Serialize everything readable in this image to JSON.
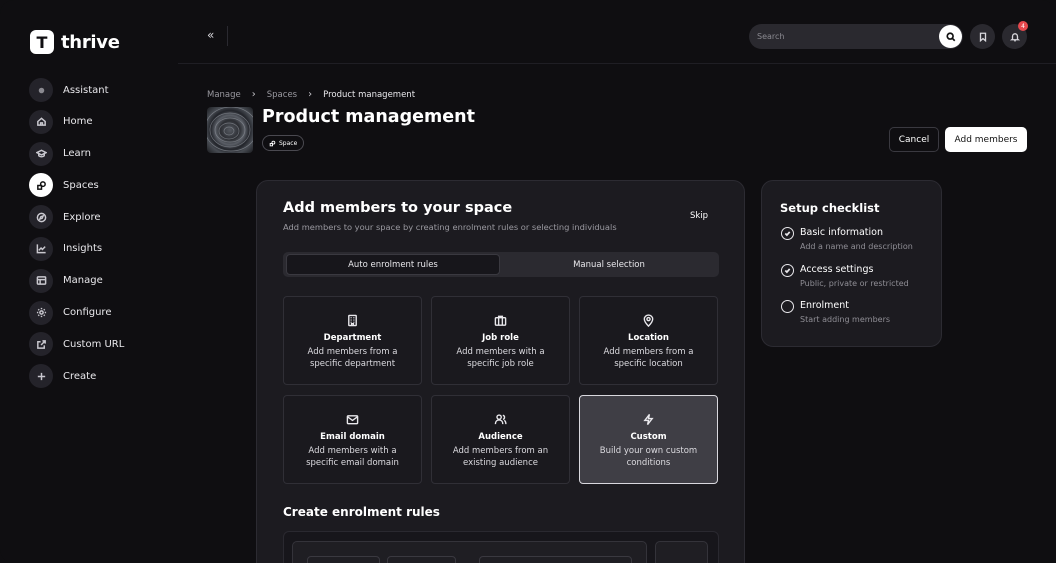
{
  "app": {
    "logo_letter": "T",
    "name": "thrive"
  },
  "sidebar": {
    "items": [
      {
        "label": "Assistant",
        "icon": "assistant-icon"
      },
      {
        "label": "Home",
        "icon": "home-icon"
      },
      {
        "label": "Learn",
        "icon": "graduation-cap-icon"
      },
      {
        "label": "Spaces",
        "icon": "spaces-icon",
        "active": true
      },
      {
        "label": "Explore",
        "icon": "compass-icon"
      },
      {
        "label": "Insights",
        "icon": "chart-icon"
      },
      {
        "label": "Manage",
        "icon": "manage-icon"
      },
      {
        "label": "Configure",
        "icon": "gear-icon"
      },
      {
        "label": "Custom URL",
        "icon": "external-link-icon"
      },
      {
        "label": "Create",
        "icon": "plus-icon"
      }
    ]
  },
  "topbar": {
    "collapse_label": "«",
    "search_placeholder": "Search",
    "notification_count": "4"
  },
  "breadcrumb": {
    "items": [
      "Manage",
      "Spaces",
      "Product management"
    ]
  },
  "header": {
    "title": "Product management",
    "pill_label": "Space",
    "cancel_label": "Cancel",
    "add_members_label": "Add members"
  },
  "card": {
    "title": "Add members to your space",
    "subtitle": "Add members to your space by creating enrolment rules or selecting individuals",
    "skip_label": "Skip",
    "tabs": [
      {
        "label": "Auto enrolment rules",
        "active": true
      },
      {
        "label": "Manual selection",
        "active": false
      }
    ],
    "options": [
      {
        "title": "Department",
        "desc": "Add members from a specific department",
        "icon": "building-icon"
      },
      {
        "title": "Job role",
        "desc": "Add members with a specific job role",
        "icon": "briefcase-icon"
      },
      {
        "title": "Location",
        "desc": "Add members from a specific location",
        "icon": "map-pin-icon"
      },
      {
        "title": "Email domain",
        "desc": "Add members with a specific email domain",
        "icon": "mail-icon"
      },
      {
        "title": "Audience",
        "desc": "Add members from an existing audience",
        "icon": "users-icon"
      },
      {
        "title": "Custom",
        "desc": "Build your own custom conditions",
        "icon": "lightning-icon",
        "selected": true
      }
    ],
    "rules_title": "Create enrolment rules"
  },
  "checklist": {
    "title": "Setup checklist",
    "items": [
      {
        "title": "Basic information",
        "desc": "Add a name and description",
        "done": true
      },
      {
        "title": "Access settings",
        "desc": "Public, private or restricted",
        "done": true
      },
      {
        "title": "Enrolment",
        "desc": "Start adding members",
        "done": false
      }
    ]
  },
  "colors": {
    "background": "#0f0e11",
    "card": "#1c1b20",
    "accent": "#ffffff",
    "badge": "#e5484d"
  }
}
